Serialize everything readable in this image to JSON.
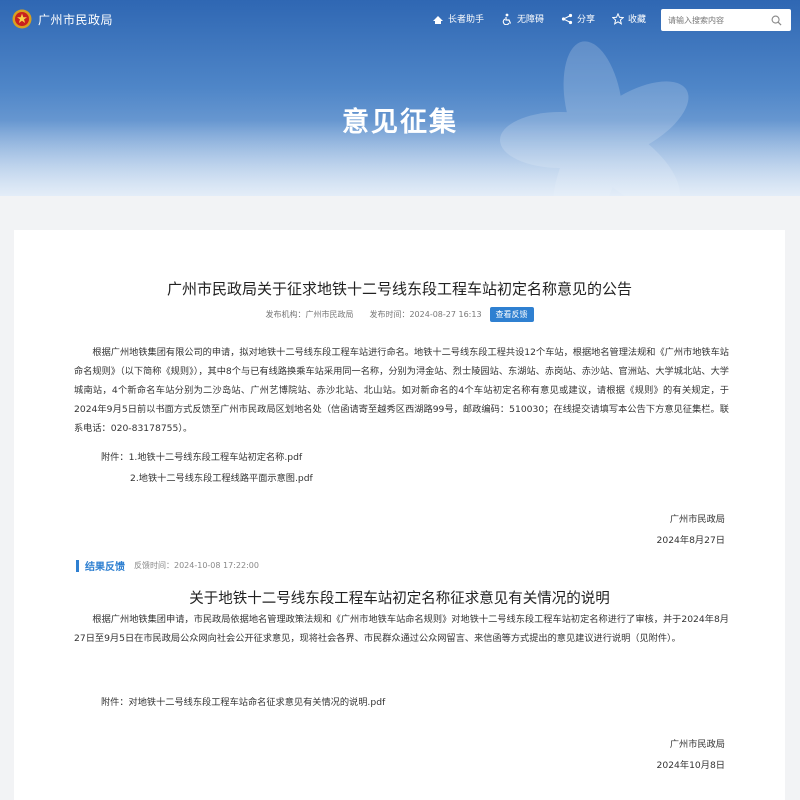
{
  "header": {
    "site_name": "广州市民政局",
    "tools": [
      {
        "label": "长者助手",
        "icon": "elder-assistant-icon"
      },
      {
        "label": "无障碍",
        "icon": "accessibility-icon"
      },
      {
        "label": "分享",
        "icon": "share-icon"
      },
      {
        "label": "收藏",
        "icon": "favorite-icon"
      }
    ],
    "search": {
      "placeholder": "请输入搜索内容",
      "icon": "search-icon"
    }
  },
  "banner": {
    "title": "意见征集"
  },
  "notice": {
    "title": "广州市民政局关于征求地铁十二号线东段工程车站初定名称意见的公告",
    "publisher_label": "发布机构：",
    "publisher": "广州市民政局",
    "time_label": "发布时间：",
    "time": "2024-08-27 16:13",
    "feedback_button": "查看反馈",
    "body": "根据广州地铁集团有限公司的申请，拟对地铁十二号线东段工程车站进行命名。地铁十二号线东段工程共设12个车站，根据地名管理法规和《广州市地铁车站命名规则》（以下简称《规则》），其中8个与已有线路换乘车站采用同一名称，分别为浔金站、烈士陵园站、东湖站、赤岗站、赤沙站、官洲站、大学城北站、大学城南站，4个新命名车站分别为二沙岛站、广州艺博院站、赤沙北站、北山站。如对新命名的4个车站初定名称有意见或建议，请根据《规则》的有关规定，于2024年9月5日前以书面方式反馈至广州市民政局区划地名处（信函请寄至越秀区西湖路99号，邮政编码：510030；在线提交请填写本公告下方意见征集栏。联系电话：020-83178755）。",
    "attachment_label": "附件：",
    "attachments": [
      "1.地铁十二号线东段工程车站初定名称.pdf",
      "2.地铁十二号线东段工程线路平面示意图.pdf"
    ],
    "sign_org": "广州市民政局",
    "sign_date": "2024年8月27日"
  },
  "feedback": {
    "label": "结果反馈",
    "time": "反馈时间：2024-10-08 17:22:00",
    "title": "关于地铁十二号线东段工程车站初定名称征求意见有关情况的说明",
    "body": "根据广州地铁集团申请，市民政局依据地名管理政策法规和《广州市地铁车站命名规则》对地铁十二号线东段工程车站初定名称进行了审核，并于2024年8月27日至9月5日在市民政局公众网向社会公开征求意见，现将社会各界、市民群众通过公众网留言、来信函等方式提出的意见建议进行说明（见附件）。",
    "attachment": "附件：对地铁十二号线东段工程车站命名征求意见有关情况的说明.pdf",
    "sign_org": "广州市民政局",
    "sign_date": "2024年10月8日"
  },
  "colors": {
    "brand_blue": "#2f67b3",
    "accent": "#2f80d1",
    "page_bg": "#f2f3f5"
  }
}
